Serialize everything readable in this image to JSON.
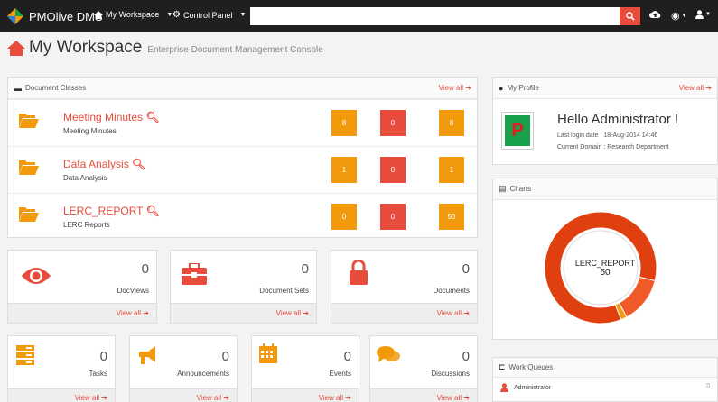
{
  "colors": {
    "accent": "#e74c3c",
    "orange": "#f29a0c",
    "dark": "#1f1f1f"
  },
  "topbar": {
    "brand": "PMOlive DMS",
    "nav": [
      {
        "label": "My Workspace",
        "icon": "home-icon"
      },
      {
        "label": "Control Panel",
        "icon": "cogs-icon"
      }
    ],
    "search": {
      "placeholder": "",
      "value": ""
    }
  },
  "page": {
    "title": "My Workspace",
    "subtitle": "Enterprise Document Management Console"
  },
  "document_classes": {
    "title": "Document Classes",
    "view_all": "View all",
    "rows": [
      {
        "name": "Meeting Minutes",
        "desc": "Meeting Minutes",
        "counts": [
          "8",
          "0",
          "8"
        ]
      },
      {
        "name": "Data Analysis",
        "desc": "Data Analysis",
        "counts": [
          "1",
          "0",
          "1"
        ]
      },
      {
        "name": "LERC_REPORT",
        "desc": "LERC Reports",
        "counts": [
          "0",
          "0",
          "50"
        ]
      }
    ]
  },
  "stats_row1": [
    {
      "value": "0",
      "label": "DocViews",
      "view_all": "View all",
      "icon": "eye-icon"
    },
    {
      "value": "0",
      "label": "Document Sets",
      "view_all": "View all",
      "icon": "briefcase-icon"
    },
    {
      "value": "0",
      "label": "Documents",
      "view_all": "View all",
      "icon": "lock-icon"
    }
  ],
  "stats_row2": [
    {
      "value": "0",
      "label": "Tasks",
      "view_all": "View all",
      "icon": "tasks-icon"
    },
    {
      "value": "0",
      "label": "Announcements",
      "view_all": "View all",
      "icon": "bullhorn-icon"
    },
    {
      "value": "0",
      "label": "Events",
      "view_all": "View all",
      "icon": "calendar-icon"
    },
    {
      "value": "0",
      "label": "Discussions",
      "view_all": "View all",
      "icon": "comments-icon"
    }
  ],
  "profile": {
    "title": "My Profile",
    "view_all": "View all",
    "avatar_letter": "P",
    "greeting": "Hello Administrator !",
    "last_login": "Last login date : 18-Aug-2014 14:46",
    "domain": "Current Domain : Research Department"
  },
  "charts": {
    "title": "Charts",
    "center_label": "LERC_REPORT",
    "center_value": "50"
  },
  "chart_data": {
    "type": "pie",
    "categories": [
      "LERC_REPORT",
      "Meeting Minutes",
      "Data Analysis"
    ],
    "values": [
      50,
      8,
      1
    ],
    "colors": [
      "#e0400f",
      "#ef5a28",
      "#f29a0c"
    ]
  },
  "work_queues": {
    "title": "Work Queues",
    "items": [
      {
        "label": "Administrator",
        "count": "0"
      }
    ]
  }
}
